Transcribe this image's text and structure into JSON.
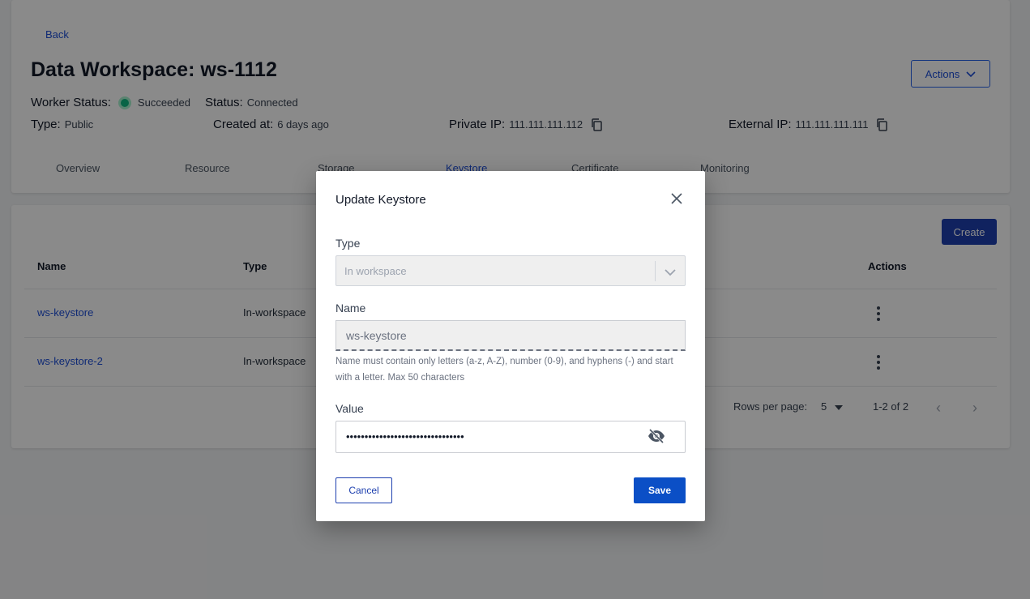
{
  "header": {
    "back_label": "Back",
    "title": "Data Workspace: ws-1112",
    "actions_label": "Actions",
    "worker_status_label": "Worker Status:",
    "worker_status_value": "Succeeded",
    "status_label": "Status:",
    "status_value": "Connected",
    "type_label": "Type:",
    "type_value": "Public",
    "created_label": "Created at:",
    "created_value": "6 days ago",
    "private_ip_label": "Private IP:",
    "private_ip_value": "111.111.111.112",
    "external_ip_label": "External IP:",
    "external_ip_value": "111.111.111.111",
    "status_color": "#10b981"
  },
  "tabs": [
    {
      "label": "Overview"
    },
    {
      "label": "Resource"
    },
    {
      "label": "Storage"
    },
    {
      "label": "Keystore"
    },
    {
      "label": "Certificate"
    },
    {
      "label": "Monitoring"
    }
  ],
  "table": {
    "create_label": "Create",
    "columns": {
      "name": "Name",
      "type": "Type",
      "actions": "Actions"
    },
    "rows": [
      {
        "name": "ws-keystore",
        "type": "In-workspace"
      },
      {
        "name": "ws-keystore-2",
        "type": "In-workspace"
      }
    ],
    "rows_per_page_label": "Rows per page:",
    "rows_per_page_value": "5",
    "range_label": "1-2 of 2"
  },
  "modal": {
    "title": "Update Keystore",
    "type_label": "Type",
    "type_value": "In workspace",
    "name_label": "Name",
    "name_value": "ws-keystore",
    "name_helper": "Name must contain only letters (a-z, A-Z), number (0-9), and hyphens (-) and start with a letter. Max 50 characters",
    "value_label": "Value",
    "value_masked": "••••••••••••••••••••••••••••••••",
    "cancel_label": "Cancel",
    "save_label": "Save",
    "primary_color": "#0b4fc6"
  }
}
